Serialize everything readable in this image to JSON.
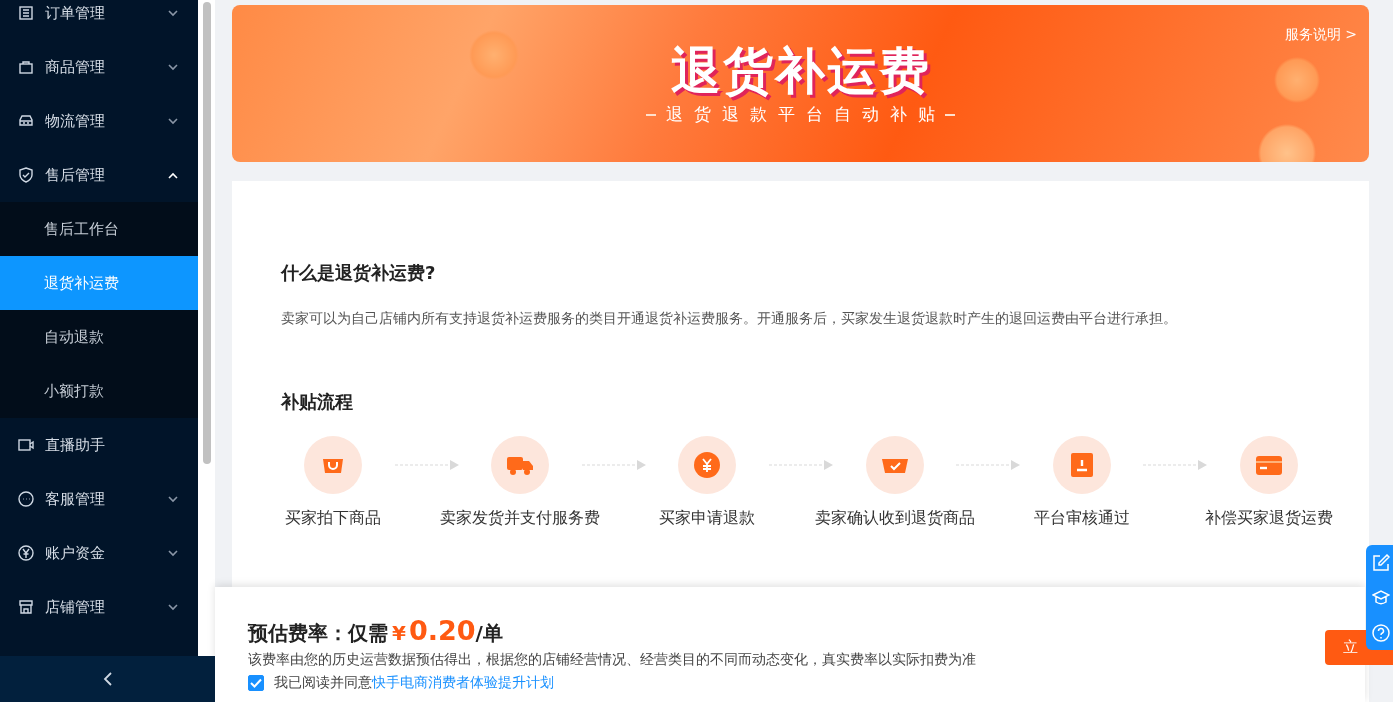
{
  "sidebar": {
    "items": [
      {
        "label": "订单管理",
        "kind": "list",
        "expandable": true,
        "expanded": false,
        "selected": false
      },
      {
        "label": "商品管理",
        "kind": "bag",
        "expandable": true,
        "expanded": false,
        "selected": false
      },
      {
        "label": "物流管理",
        "kind": "car",
        "expandable": true,
        "expanded": false,
        "selected": false
      },
      {
        "label": "售后管理",
        "kind": "shield",
        "expandable": true,
        "expanded": true,
        "selected": false,
        "children": [
          {
            "label": "售后工作台",
            "selected": false
          },
          {
            "label": "退货补运费",
            "selected": true
          },
          {
            "label": "自动退款",
            "selected": false
          },
          {
            "label": "小额打款",
            "selected": false
          }
        ]
      },
      {
        "label": "直播助手",
        "kind": "video",
        "expandable": false,
        "selected": false
      },
      {
        "label": "客服管理",
        "kind": "chat",
        "expandable": true,
        "expanded": false,
        "selected": false
      },
      {
        "label": "账户资金",
        "kind": "yen",
        "expandable": true,
        "expanded": false,
        "selected": false
      },
      {
        "label": "店铺管理",
        "kind": "shop",
        "expandable": true,
        "expanded": false,
        "selected": false
      }
    ]
  },
  "banner": {
    "title": "退货补运费",
    "subtitle": "退货退款平台自动补贴",
    "link": "服务说明 >"
  },
  "intro": {
    "heading": "什么是退货补运费?",
    "text": "卖家可以为自己店铺内所有支持退货补运费服务的类目开通退货补运费服务。开通服务后，买家发生退货退款时产生的退回运费由平台进行承担。"
  },
  "process": {
    "heading": "补贴流程",
    "steps": [
      {
        "label": "买家拍下商品",
        "kind": "bag"
      },
      {
        "label": "卖家发货并支付服务费",
        "kind": "truck"
      },
      {
        "label": "买家申请退款",
        "kind": "yen"
      },
      {
        "label": "卖家确认收到退货商品",
        "kind": "check"
      },
      {
        "label": "平台审核通过",
        "kind": "stamp"
      },
      {
        "label": "补偿买家退货运费",
        "kind": "wallet"
      }
    ]
  },
  "footer": {
    "rate_label": "预估费率：仅需",
    "currency": "¥",
    "amount": "0.20",
    "unit": "/单",
    "note": "该费率由您的历史运营数据预估得出，根据您的店铺经营情况、经营类目的不同而动态变化，真实费率以实际扣费为准",
    "agree_checked": true,
    "agree_text": "我已阅读并同意",
    "agree_link": "快手电商消费者体验提升计划",
    "button": "立"
  }
}
